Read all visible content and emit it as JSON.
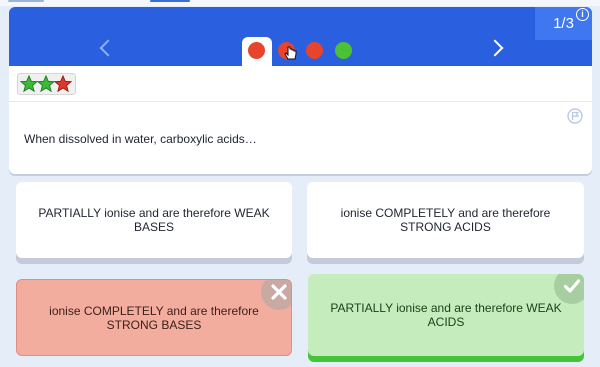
{
  "header": {
    "counter": "1/3",
    "info_icon_glyph": "i",
    "progress_dots": [
      {
        "status": "wrong",
        "color": "#e8442c"
      },
      {
        "status": "wrong",
        "color": "#e8442c"
      },
      {
        "status": "wrong",
        "color": "#e8442c"
      },
      {
        "status": "correct",
        "color": "#4bc236"
      }
    ],
    "nav_color": "#2a5fe0"
  },
  "rating": {
    "stars": [
      {
        "color": "#3cb83a"
      },
      {
        "color": "#3cb83a"
      },
      {
        "color": "#e0372a"
      }
    ]
  },
  "question": {
    "text": "When dissolved in water, carboxylic acids…"
  },
  "answers": [
    {
      "label": "PARTIALLY ionise and are therefore WEAK BASES",
      "state": "neutral"
    },
    {
      "label": "ionise COMPLETELY and are therefore STRONG ACIDS",
      "state": "neutral"
    },
    {
      "label": "ionise COMPLETELY and are therefore STRONG BASES",
      "state": "wrong"
    },
    {
      "label": "PARTIALLY ionise and are therefore WEAK ACIDS",
      "state": "correct"
    }
  ],
  "icons": {
    "prev": "chevron-left-icon",
    "next": "chevron-right-icon",
    "flag": "flag-icon",
    "wrong": "x-icon",
    "correct": "check-icon",
    "cursor": "hand-pointer-icon"
  }
}
